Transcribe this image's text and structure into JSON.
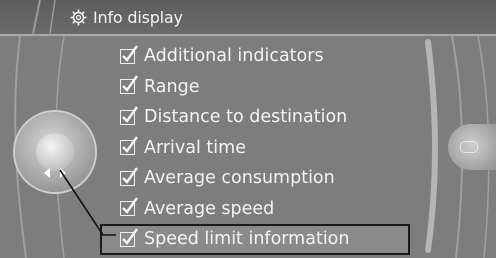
{
  "header": {
    "title": "Info display",
    "icon": "gear-icon"
  },
  "menu": {
    "items": [
      {
        "label": "Additional indicators",
        "checked": true
      },
      {
        "label": "Range",
        "checked": true
      },
      {
        "label": "Distance to destination",
        "checked": true
      },
      {
        "label": "Arrival time",
        "checked": true
      },
      {
        "label": "Average consumption",
        "checked": true
      },
      {
        "label": "Average speed",
        "checked": true
      },
      {
        "label": "Speed limit information",
        "checked": true,
        "selected": true
      }
    ]
  },
  "controller": {
    "left_icon": "arrow-left-icon",
    "right_icon": "arrow-right-icon"
  },
  "colors": {
    "background": "#7d7d7d",
    "text": "#f4f4f4",
    "selection_outline": "#1a1a1a"
  }
}
